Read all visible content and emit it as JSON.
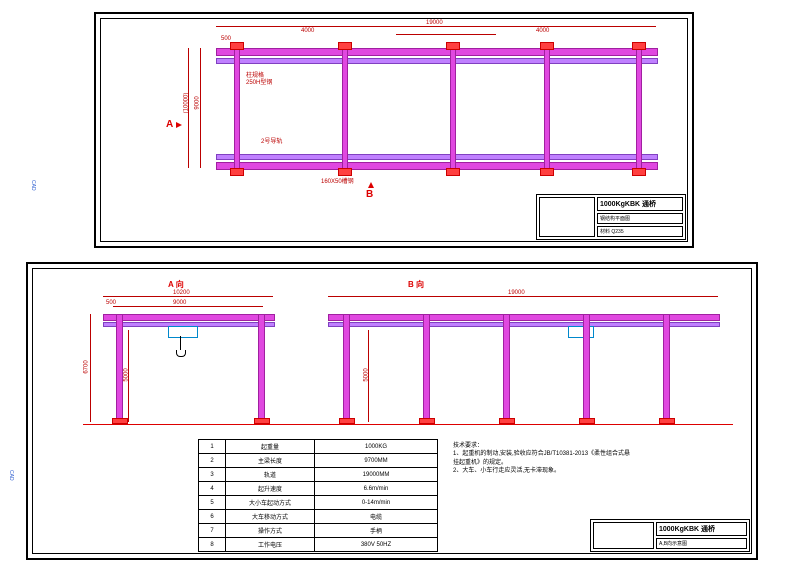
{
  "top": {
    "dim_total": "19000",
    "dim_span": "4000",
    "dim_span2": "4000",
    "dim_side": "500",
    "dim_width": "9000",
    "dim_width2": "(10000)",
    "section_a": "A",
    "section_b": "B",
    "note1": "柱规格",
    "note2": "250H型钢",
    "note3": "2号导轨",
    "note4": "160X50槽钢",
    "titleblock": {
      "product": "1000KgKBK 通桥",
      "sub": "钢结构平面图",
      "mat": "材料 Q235"
    }
  },
  "bottom": {
    "section_a": "A   向",
    "section_b": "B   向",
    "dim_10200": "10200",
    "dim_9000": "9000",
    "dim_500": "500",
    "dim_6700": "6700",
    "dim_5000": "5000",
    "dim_5000b": "5000",
    "dim_19000": "19000",
    "spec": [
      [
        "1",
        "起重量",
        "1000KG"
      ],
      [
        "2",
        "主梁长度",
        "9700MM"
      ],
      [
        "3",
        "轨道",
        "19000MM"
      ],
      [
        "4",
        "起升速度",
        "6.6m/min"
      ],
      [
        "5",
        "大小车起动方式",
        "0-14m/min"
      ],
      [
        "6",
        "大车移动方式",
        "电缆"
      ],
      [
        "7",
        "操作方式",
        "手柄"
      ],
      [
        "8",
        "工作电压",
        "380V 50HZ"
      ]
    ],
    "notes_title": "技术要求：",
    "notes": [
      "1、起重机的制动,安装,验收应符合JB/T10381-2013《柔性组合式悬",
      "挂起重机》的规定。",
      "2、大车、小车行走应灵活,无卡滞现象。"
    ],
    "titleblock": {
      "product": "1000KgKBK 通桥",
      "sub": "A,B向示意图"
    }
  },
  "cad_label": "CAD"
}
